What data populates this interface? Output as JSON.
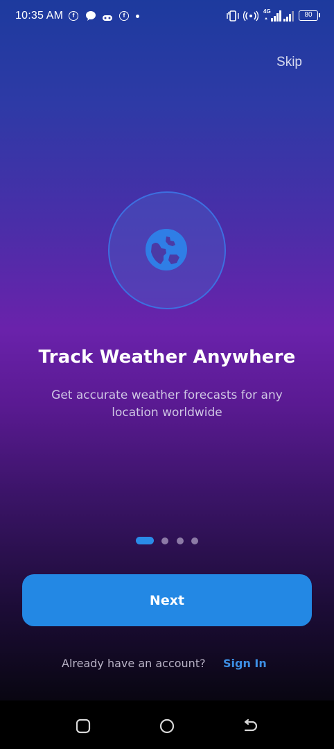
{
  "status_bar": {
    "time": "10:35 AM",
    "notification_icons": [
      "facebook-icon",
      "messenger-icon",
      "gamepad-icon",
      "facebook-icon",
      "dot-icon"
    ],
    "network_label": "4G",
    "battery": "80"
  },
  "header": {
    "skip_label": "Skip"
  },
  "onboarding": {
    "illustration_icon": "globe-icon",
    "title": "Track Weather Anywhere",
    "description": "Get accurate weather forecasts for any location worldwide",
    "page_count": 4,
    "current_page": 1
  },
  "actions": {
    "next_label": "Next",
    "account_prompt": "Already have an account?",
    "sign_in_label": "Sign In"
  },
  "navigation_bar": {
    "buttons": [
      "recent-apps-icon",
      "home-icon",
      "back-icon"
    ]
  },
  "colors": {
    "accent": "#2388e4",
    "link": "#3d8ee3",
    "indicator_inactive": "#8c7aa6"
  }
}
